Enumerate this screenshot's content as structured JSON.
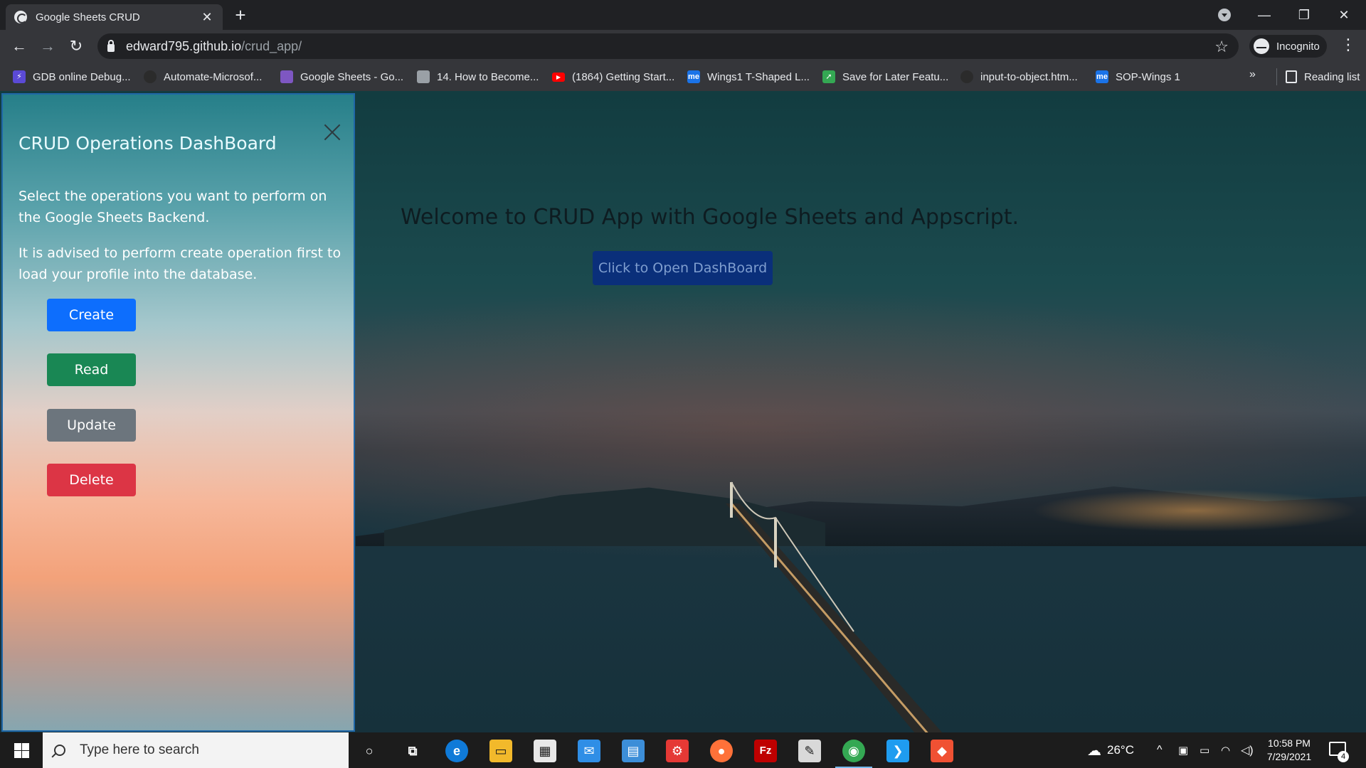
{
  "browser": {
    "tab_title": "Google Sheets CRUD",
    "tab_close_glyph": "✕",
    "new_tab_glyph": "+",
    "url_host": "edward795.github.io",
    "url_path": "/crud_app/",
    "profile_label": "Incognito",
    "window_controls": {
      "minimize": "—",
      "restore": "❐",
      "close": "✕"
    },
    "nav": {
      "back": "←",
      "forward": "→",
      "reload": "↻",
      "star": "☆",
      "menu": "⋮"
    }
  },
  "bookmarks": {
    "items": [
      {
        "label": "GDB online Debug...",
        "icon": "lightning-icon",
        "color": "#5b4ad6"
      },
      {
        "label": "Automate-Microsof...",
        "icon": "github-icon",
        "color": "#2b2b2b"
      },
      {
        "label": "Google Sheets - Go...",
        "icon": "sheets-icon",
        "color": "#7e57c2"
      },
      {
        "label": "14. How to Become...",
        "icon": "book-icon",
        "color": "#9aa0a6"
      },
      {
        "label": "(1864) Getting Start...",
        "icon": "youtube-icon",
        "color": "#ff0000"
      },
      {
        "label": "Wings1 T-Shaped L...",
        "icon": "me-icon",
        "color": "#1a73e8"
      },
      {
        "label": "Save for Later Featu...",
        "icon": "arrow-icon",
        "color": "#34a853"
      },
      {
        "label": "input-to-object.htm...",
        "icon": "github-icon",
        "color": "#2b2b2b"
      },
      {
        "label": "SOP-Wings 1",
        "icon": "me-icon",
        "color": "#1a73e8"
      }
    ],
    "more_glyph": "»",
    "reading_list": "Reading list"
  },
  "main": {
    "welcome": "Welcome to CRUD App with Google Sheets and Appscript.",
    "open_button": "Click to Open DashBoard"
  },
  "panel": {
    "title": "CRUD Operations DashBoard",
    "intro": "Select the operations you want to perform on the Google Sheets Backend.",
    "advice": "It is advised to perform create operation first to load your profile into the database.",
    "buttons": [
      {
        "label": "Create",
        "color": "#0d6efd"
      },
      {
        "label": "Read",
        "color": "#198754"
      },
      {
        "label": "Update",
        "color": "#6c757d"
      },
      {
        "label": "Delete",
        "color": "#dc3545"
      }
    ]
  },
  "taskbar": {
    "search_placeholder": "Type here to search",
    "weather": "26°C",
    "time": "10:58 PM",
    "date": "7/29/2021",
    "notification_count": "4",
    "apps": [
      {
        "name": "cortana-icon",
        "glyph": "○",
        "color": "#1c1c1c"
      },
      {
        "name": "task-view-icon",
        "glyph": "⧉",
        "color": "#1c1c1c"
      },
      {
        "name": "edge-icon",
        "glyph": "e",
        "color": "#0f7ad8"
      },
      {
        "name": "file-explorer-icon",
        "glyph": "▭",
        "color": "#f2b92b"
      },
      {
        "name": "store-icon",
        "glyph": "▦",
        "color": "#e8e8e8"
      },
      {
        "name": "mail-icon",
        "glyph": "✉",
        "color": "#2f8ee6"
      },
      {
        "name": "control-panel-icon",
        "glyph": "▤",
        "color": "#3c8ed8"
      },
      {
        "name": "app-icon",
        "glyph": "⚙",
        "color": "#e53935"
      },
      {
        "name": "firefox-icon",
        "glyph": "●",
        "color": "#ff7139"
      },
      {
        "name": "filezilla-icon",
        "glyph": "Fz",
        "color": "#bf0000"
      },
      {
        "name": "notepad-icon",
        "glyph": "✎",
        "color": "#d9d9d9"
      },
      {
        "name": "chrome-icon",
        "glyph": "◉",
        "color": "#34a853"
      },
      {
        "name": "vscode-icon",
        "glyph": "❯",
        "color": "#1f9cf0"
      },
      {
        "name": "git-icon",
        "glyph": "◆",
        "color": "#f05133"
      }
    ]
  }
}
